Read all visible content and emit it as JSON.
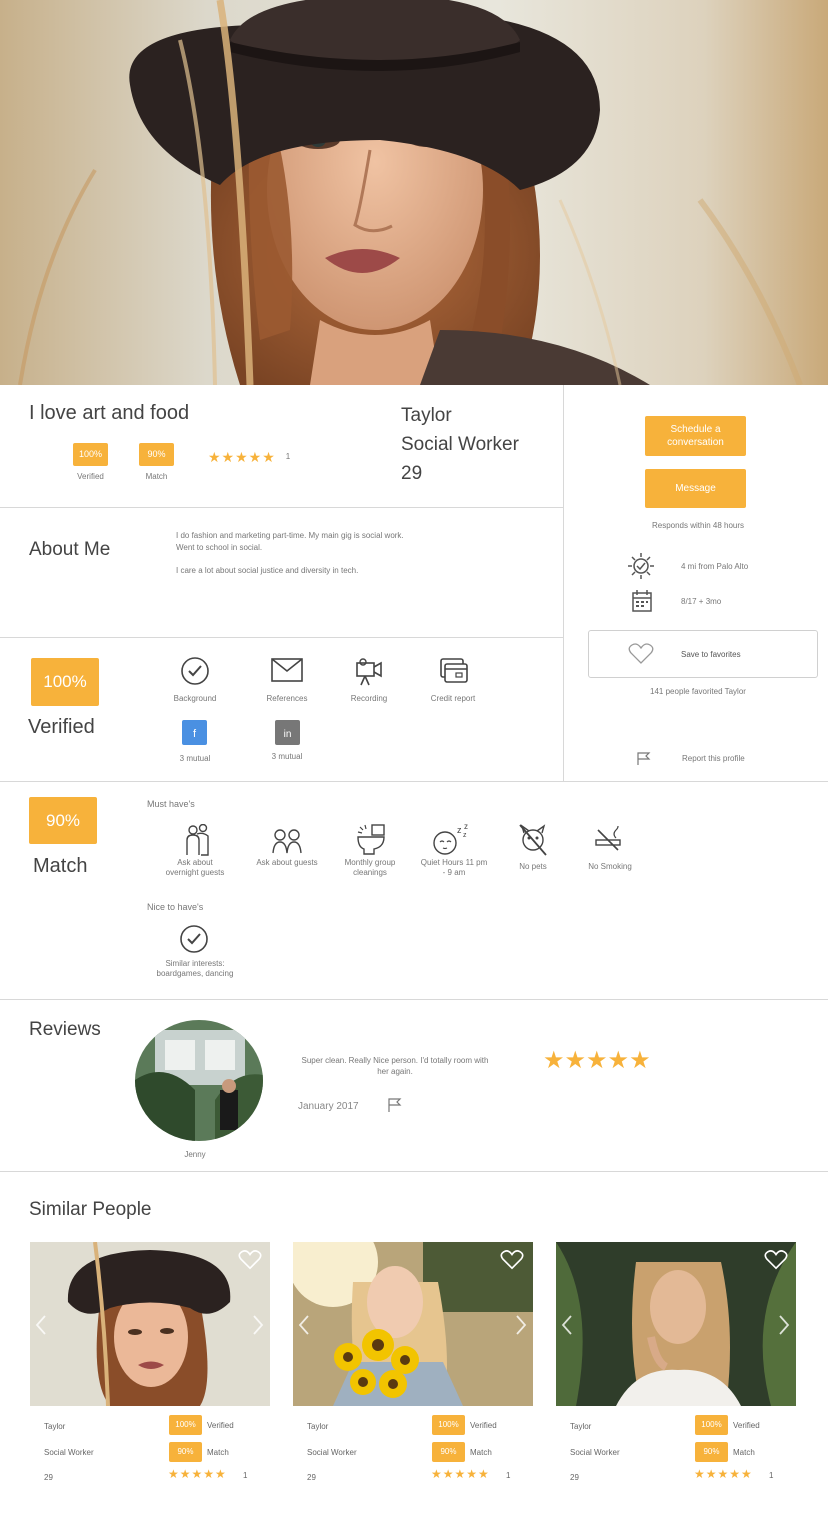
{
  "profile": {
    "tagline": "I love art and food",
    "name": "Taylor",
    "occupation": "Social Worker",
    "age": "29",
    "verified_pct": "100%",
    "verified_label": "Verified",
    "match_pct": "90%",
    "match_label": "Match",
    "rating_stars": "★★★★★",
    "rating_count": "1"
  },
  "actions": {
    "schedule_label": "Schedule a conversation",
    "message_label": "Message",
    "responds": "Responds within 48 hours",
    "distance": "4 mi from Palo Alto",
    "date": "8/17 + 3mo",
    "save_label": "Save to favorites",
    "favorited": "141 people favorited Taylor",
    "report_label": "Report this profile"
  },
  "about": {
    "title": "About Me",
    "line1": "I do fashion and marketing part-time. My main gig is social work.",
    "line2": "Went to school in social.",
    "line3": "I care a lot about social justice and diversity in tech."
  },
  "verification": {
    "big_pct": "100%",
    "big_label": "Verified",
    "items": [
      "Background",
      "References",
      "Recording",
      "Credit report",
      "3 mutual",
      "3 mutual"
    ]
  },
  "match": {
    "big_pct": "90%",
    "big_label": "Match",
    "must_title": "Must have's",
    "must_items": [
      "Ask about overnight guests",
      "Ask about guests",
      "Monthly group cleanings",
      "Quiet Hours 11 pm - 9 am",
      "No pets",
      "No Smoking"
    ],
    "nice_title": "Nice to have's",
    "nice_item": "Similar interests: boardgames, dancing"
  },
  "reviews": {
    "title": "Reviews",
    "text": "Super clean. Really Nice person. I'd totally room with her again.",
    "date": "January 2017",
    "reviewer": "Jenny",
    "stars": "★★★★★"
  },
  "similar": {
    "title": "Similar People",
    "cards": [
      {
        "name": "Taylor",
        "job": "Social Worker",
        "age": "29",
        "verified_pct": "100%",
        "verified": "Verified",
        "match_pct": "90%",
        "match": "Match",
        "stars": "★★★★★",
        "count": "1"
      },
      {
        "name": "Taylor",
        "job": "Social Worker",
        "age": "29",
        "verified_pct": "100%",
        "verified": "Verified",
        "match_pct": "90%",
        "match": "Match",
        "stars": "★★★★★",
        "count": "1"
      },
      {
        "name": "Taylor",
        "job": "Social Worker",
        "age": "29",
        "verified_pct": "100%",
        "verified": "Verified",
        "match_pct": "90%",
        "match": "Match",
        "stars": "★★★★★",
        "count": "1"
      }
    ]
  },
  "colors": {
    "accent": "#f7b23b",
    "divider": "#d8d8d8"
  }
}
